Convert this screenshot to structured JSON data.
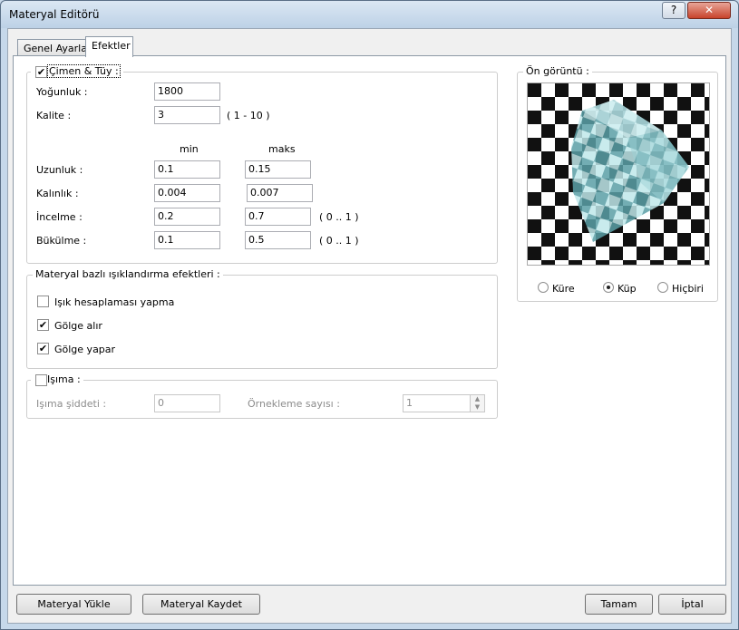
{
  "window": {
    "title": "Materyal Editörü",
    "help_label": "?",
    "close_label": "✕"
  },
  "tabs": [
    {
      "label": "Genel Ayarlar"
    },
    {
      "label": "Efektler"
    }
  ],
  "grass": {
    "label": "Çimen & Tüy :",
    "checked": true,
    "density_label": "Yoğunluk :",
    "density_value": "1800",
    "quality_label": "Kalite :",
    "quality_value": "3",
    "quality_range": "( 1 - 10 )",
    "min_header": "min",
    "max_header": "maks",
    "length_label": "Uzunluk :",
    "length_min": "0.1",
    "length_max": "0.15",
    "thickness_label": "Kalınlık :",
    "thickness_min": "0.004",
    "thickness_max": "0.007",
    "taper_label": "İncelme :",
    "taper_min": "0.2",
    "taper_max": "0.7",
    "taper_range": "( 0 .. 1 )",
    "bend_label": "Bükülme :",
    "bend_min": "0.1",
    "bend_max": "0.5",
    "bend_range": "( 0 .. 1 )"
  },
  "lighting": {
    "label": "Materyal bazlı ışıklandırma efektleri :",
    "no_lighting_label": "Işık hesaplaması yapma",
    "no_lighting_checked": false,
    "receives_shadow_label": "Gölge alır",
    "receives_shadow_checked": true,
    "casts_shadow_label": "Gölge yapar",
    "casts_shadow_checked": true
  },
  "glow": {
    "label": "Işıma :",
    "checked": false,
    "intensity_label": "Işıma şiddeti :",
    "intensity_value": "0",
    "samples_label": "Örnekleme sayısı :",
    "samples_value": "1"
  },
  "preview": {
    "label": "Ön görüntü :",
    "options": [
      {
        "label": "Küre",
        "selected": false
      },
      {
        "label": "Küp",
        "selected": true
      },
      {
        "label": "Hiçbiri",
        "selected": false
      }
    ]
  },
  "footer": {
    "load_label": "Materyal Yükle",
    "save_label": "Materyal Kaydet",
    "ok_label": "Tamam",
    "cancel_label": "İptal"
  }
}
